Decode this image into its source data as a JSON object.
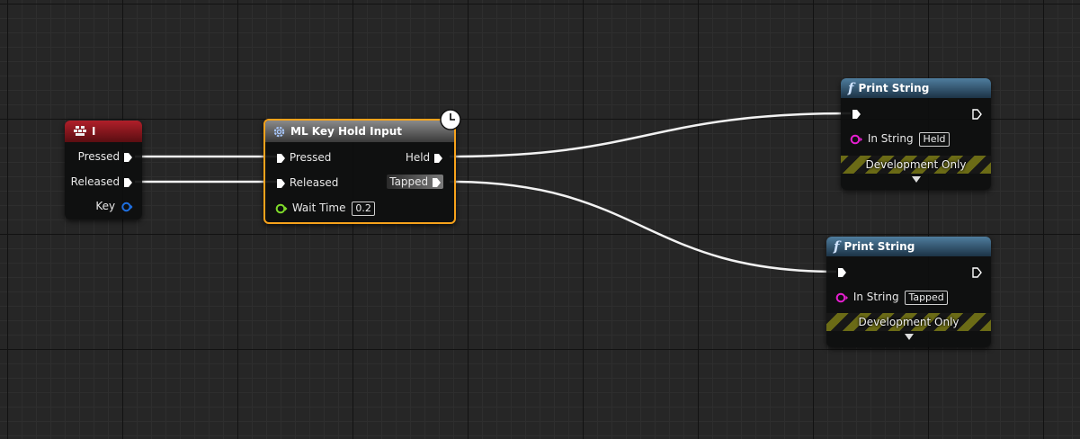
{
  "key_node": {
    "title": "I",
    "pins": {
      "pressed": "Pressed",
      "released": "Released",
      "key": "Key"
    }
  },
  "hold_node": {
    "title": "ML Key Hold Input",
    "inputs": {
      "pressed": "Pressed",
      "released": "Released",
      "wait_time_label": "Wait Time",
      "wait_time_value": "0.2"
    },
    "outputs": {
      "held": "Held",
      "tapped": "Tapped"
    }
  },
  "print_held": {
    "title": "Print String",
    "in_string_label": "In String",
    "in_string_value": "Held",
    "footer": "Development Only"
  },
  "print_tapped": {
    "title": "Print String",
    "in_string_label": "In String",
    "in_string_value": "Tapped",
    "footer": "Development Only"
  },
  "colors": {
    "exec": "#ffffff",
    "string_pin": "#e61fd0",
    "struct_pin": "#1e6fe0",
    "float_pin": "#7fdb2a",
    "selected": "#f7a21b"
  }
}
